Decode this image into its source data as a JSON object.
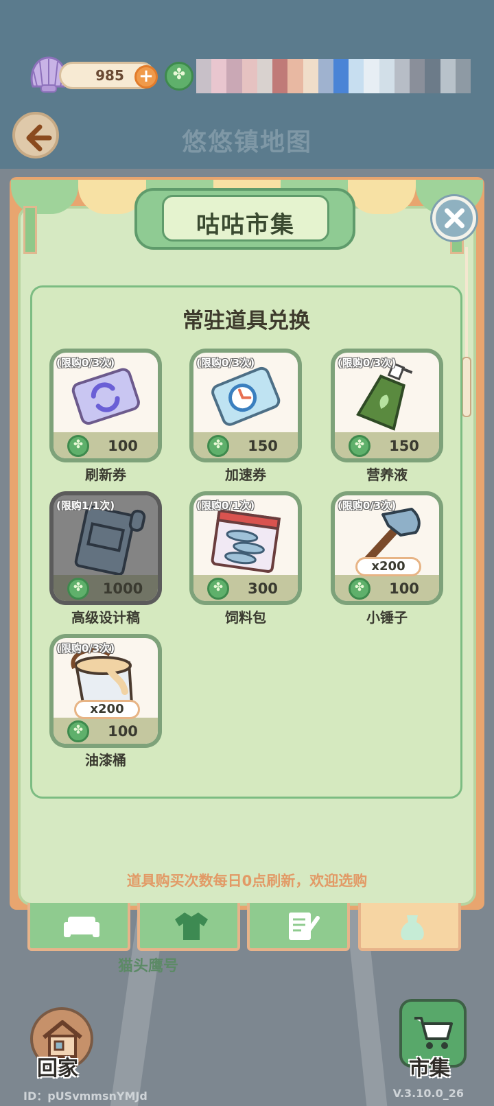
{
  "header": {
    "shell_count": "985",
    "page_title": "悠悠镇地图"
  },
  "market": {
    "title": "咕咕市集",
    "section_title": "常驻道具兑换",
    "items": [
      {
        "limit": "(限购0/3次)",
        "price": "100",
        "name": "刷新券",
        "icon": "refresh-ticket-icon"
      },
      {
        "limit": "(限购0/3次)",
        "price": "150",
        "name": "加速券",
        "icon": "speed-ticket-icon"
      },
      {
        "limit": "(限购0/3次)",
        "price": "150",
        "name": "营养液",
        "icon": "nutrient-bottle-icon"
      },
      {
        "limit": "(限购1/1次)",
        "price": "1000",
        "name": "高级设计稿",
        "icon": "blueprint-icon",
        "sold_out": true
      },
      {
        "limit": "(限购0/1次)",
        "price": "300",
        "name": "饲料包",
        "icon": "fish-feed-pack-icon"
      },
      {
        "limit": "(限购0/3次)",
        "price": "100",
        "name": "小锤子",
        "icon": "hammer-icon",
        "quantity": "x200"
      },
      {
        "limit": "(限购0/3次)",
        "price": "100",
        "name": "油漆桶",
        "icon": "paint-bucket-icon",
        "quantity": "x200"
      }
    ],
    "notice": "道具购买次数每日0点刷新，欢迎选购"
  },
  "tabs": {
    "items": [
      "sofa-icon",
      "shirt-icon",
      "note-icon",
      "bag-icon"
    ],
    "caption": "猫头鹰号"
  },
  "nav": {
    "home_label": "回家",
    "market_label": "市集"
  },
  "footer": {
    "user_id": "ID：pUSvmmsnYMJd",
    "version": "V.3.10.0_26"
  },
  "colors": {
    "accent_green": "#5fb06b",
    "panel_green": "#d5e9bf",
    "frame_orange": "#e8a56f",
    "notice_orange": "#e29a66"
  }
}
